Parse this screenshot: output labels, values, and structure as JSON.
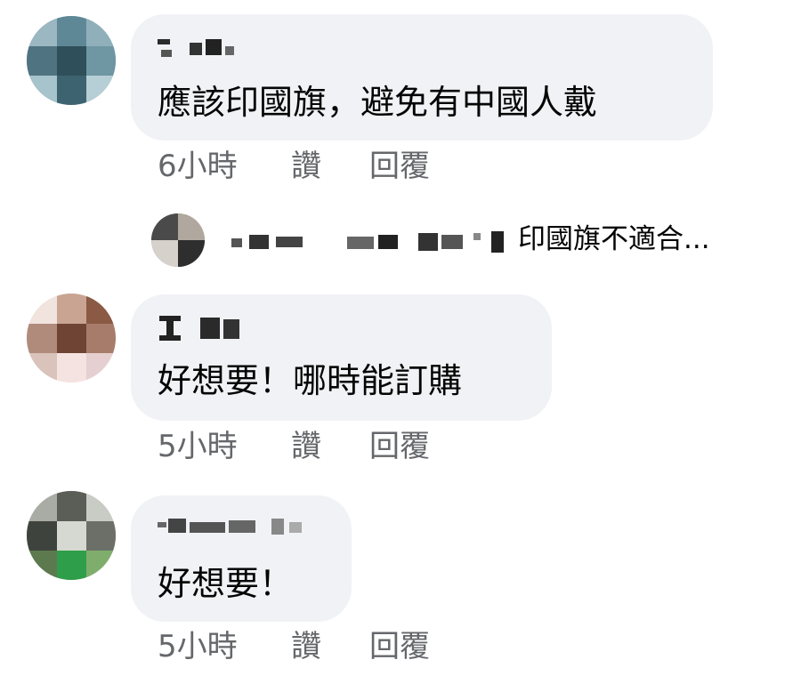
{
  "comments": [
    {
      "author": "",
      "text": "應該印國旗，避免有中國人戴",
      "time": "6小時",
      "like_label": "讚",
      "reply_label": "回覆",
      "reply_preview": {
        "author": "",
        "snippet": "印國旗不適合..."
      }
    },
    {
      "author": "",
      "text": "好想要！哪時能訂購",
      "time": "5小時",
      "like_label": "讚",
      "reply_label": "回覆"
    },
    {
      "author": "",
      "text": "好想要！",
      "time": "5小時",
      "like_label": "讚",
      "reply_label": "回覆"
    }
  ],
  "colors": {
    "bubble": "#f0f2f5",
    "text": "#050505",
    "meta": "#65676b"
  }
}
